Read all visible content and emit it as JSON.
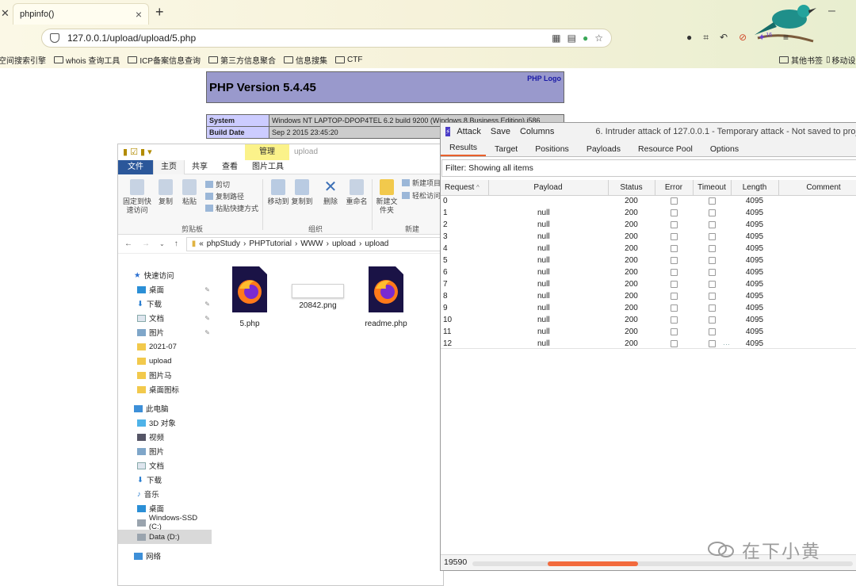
{
  "browser": {
    "tab_title": "phpinfo()",
    "url": "127.0.0.1/upload/upload/5.php",
    "bookmarks": [
      "空间搜索引擎",
      "whois 查询工具",
      "ICP备案信息查询",
      "第三方信息聚合",
      "信息搜集",
      "CTF"
    ],
    "bookmarks_right": [
      "其他书签",
      "移动设"
    ],
    "extension_badge": "16"
  },
  "phpinfo": {
    "title": "PHP Version 5.4.45",
    "logo_text": "PHP Logo",
    "rows": [
      {
        "k": "System",
        "v": "Windows NT LAPTOP-DPOP4TEL 6.2 build 9200 (Windows 8 Business Edition) i586"
      },
      {
        "k": "Build Date",
        "v": "Sep 2 2015 23:45:20"
      }
    ]
  },
  "explorer": {
    "manage_label": "管理",
    "window_name": "upload",
    "tabs": [
      "文件",
      "主页",
      "共享",
      "查看",
      "图片工具"
    ],
    "ribbon": {
      "pin": "固定到快速访问",
      "copy": "复制",
      "paste": "粘贴",
      "cut": "剪切",
      "copy_path": "复制路径",
      "paste_shortcut": "粘贴快捷方式",
      "move_to": "移动到",
      "copy_to": "复制到",
      "delete": "删除",
      "rename": "重命名",
      "new_folder": "新建文件夹",
      "new_item": "新建项目",
      "easy_access": "轻松访问",
      "group_clipboard": "剪贴板",
      "group_organize": "组织",
      "group_new": "新建"
    },
    "path": [
      "phpStudy",
      "PHPTutorial",
      "WWW",
      "upload",
      "upload"
    ],
    "nav": [
      {
        "label": "快速访问",
        "pin": false
      },
      {
        "label": "桌面",
        "pin": true
      },
      {
        "label": "下载",
        "pin": true
      },
      {
        "label": "文档",
        "pin": true
      },
      {
        "label": "图片",
        "pin": true
      },
      {
        "label": "2021-07",
        "pin": false
      },
      {
        "label": "upload",
        "pin": false
      },
      {
        "label": "图片马",
        "pin": false
      },
      {
        "label": "桌面图标",
        "pin": false
      },
      {
        "label": "此电脑",
        "pin": false
      },
      {
        "label": "3D 对象",
        "pin": false
      },
      {
        "label": "视频",
        "pin": false
      },
      {
        "label": "图片",
        "pin": false
      },
      {
        "label": "文档",
        "pin": false
      },
      {
        "label": "下载",
        "pin": false
      },
      {
        "label": "音乐",
        "pin": false
      },
      {
        "label": "桌面",
        "pin": false
      },
      {
        "label": "Windows-SSD (C:)",
        "pin": false
      },
      {
        "label": "Data (D:)",
        "pin": false
      },
      {
        "label": "网络",
        "pin": false
      }
    ],
    "files": [
      "5.php",
      "20842.png",
      "readme.php"
    ]
  },
  "burp": {
    "menu": [
      "Attack",
      "Save",
      "Columns"
    ],
    "title": "6. Intruder attack of 127.0.0.1 - Temporary attack - Not saved to project",
    "tabs": [
      "Results",
      "Target",
      "Positions",
      "Payloads",
      "Resource Pool",
      "Options"
    ],
    "filter": "Filter: Showing all items",
    "columns": [
      "Request",
      "Payload",
      "Status",
      "Error",
      "Timeout",
      "Length",
      "Comment"
    ],
    "rows": [
      {
        "req": "0",
        "payload": "",
        "status": "200",
        "length": "4095"
      },
      {
        "req": "1",
        "payload": "null",
        "status": "200",
        "length": "4095"
      },
      {
        "req": "2",
        "payload": "null",
        "status": "200",
        "length": "4095"
      },
      {
        "req": "3",
        "payload": "null",
        "status": "200",
        "length": "4095"
      },
      {
        "req": "4",
        "payload": "null",
        "status": "200",
        "length": "4095"
      },
      {
        "req": "5",
        "payload": "null",
        "status": "200",
        "length": "4095"
      },
      {
        "req": "6",
        "payload": "null",
        "status": "200",
        "length": "4095"
      },
      {
        "req": "7",
        "payload": "null",
        "status": "200",
        "length": "4095"
      },
      {
        "req": "8",
        "payload": "null",
        "status": "200",
        "length": "4095"
      },
      {
        "req": "9",
        "payload": "null",
        "status": "200",
        "length": "4095"
      },
      {
        "req": "10",
        "payload": "null",
        "status": "200",
        "length": "4095"
      },
      {
        "req": "11",
        "payload": "null",
        "status": "200",
        "length": "4095"
      },
      {
        "req": "12",
        "payload": "null",
        "status": "200",
        "length": "4095"
      }
    ],
    "count": "19590",
    "accent": "#e8602c"
  },
  "watermark": "在下小黄"
}
